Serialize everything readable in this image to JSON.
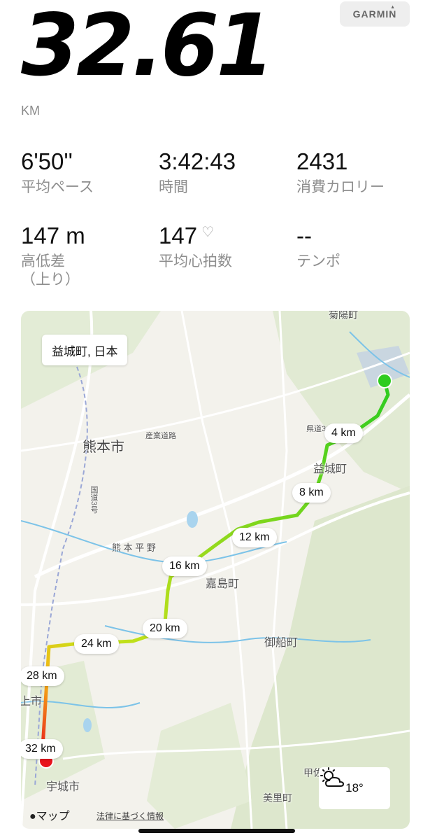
{
  "header": {
    "brand": "GARMIN",
    "distance_value": "32.61",
    "distance_unit": "KM"
  },
  "stats": [
    {
      "value": "6'50''",
      "label": "平均ペース"
    },
    {
      "value": "3:42:43",
      "label": "時間"
    },
    {
      "value": "2431",
      "label": "消費カロリー"
    },
    {
      "value": "147 m",
      "label": "高低差\n（上り）"
    },
    {
      "value": "147",
      "label": "平均心拍数",
      "icon": "heart-outline-icon"
    },
    {
      "value": "--",
      "label": "テンポ"
    }
  ],
  "map": {
    "location": "益城町, 日本",
    "km_markers": [
      "4 km",
      "8 km",
      "12 km",
      "16 km",
      "20 km",
      "24 km",
      "28 km",
      "32 km"
    ],
    "place_labels": {
      "kumamoto": "熊本市",
      "mashiki": "益城町",
      "kashima": "嘉島町",
      "mifune": "御船町",
      "uki": "宇城市",
      "misato": "美里町",
      "kikuyo": "菊陽町",
      "plain": "熊 本 平 野",
      "sangyo_road": "産業道路",
      "kokudo3": "国道3号",
      "kendo": "県道36号",
      "kosa": "甲佐",
      "uki_partial": "上市"
    },
    "route_colors": {
      "start": "#2ecc1f",
      "mid": "#c6e21a",
      "end": "#e8141c",
      "river": "#7cc3e8"
    },
    "weather": {
      "temperature": "18°",
      "icon": "partly-cloudy-sun-icon"
    },
    "attribution": "マップ",
    "legal": "法律に基づく情報"
  }
}
